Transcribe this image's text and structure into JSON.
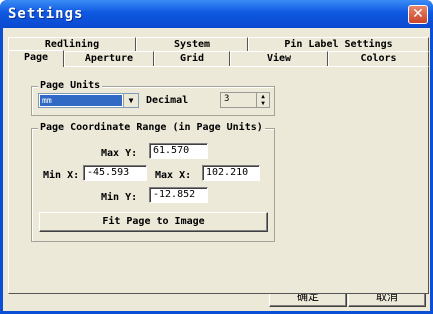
{
  "window": {
    "title": "Settings",
    "close_symbol": "✕"
  },
  "tabs": {
    "back_row": [
      "Redlining",
      "System",
      "Pin Label Settings"
    ],
    "front_row": [
      "Page",
      "Aperture",
      "Grid",
      "View",
      "Colors"
    ],
    "active": "Page"
  },
  "page_units": {
    "group_label": "Page Units",
    "unit_value": "mm",
    "decimal_label": "Decimal",
    "decimal_value": "3"
  },
  "coord_range": {
    "group_label": "Page Coordinate Range (in Page Units)",
    "max_y_label": "Max Y:",
    "max_y_value": "61.570",
    "min_x_label": "Min X:",
    "min_x_value": "-45.593",
    "max_x_label": "Max X:",
    "max_x_value": "102.210",
    "min_y_label": "Min Y:",
    "min_y_value": "-12.852",
    "fit_button": "Fit Page to Image"
  },
  "footer": {
    "ok_label": "确定",
    "cancel_label": "取消"
  }
}
